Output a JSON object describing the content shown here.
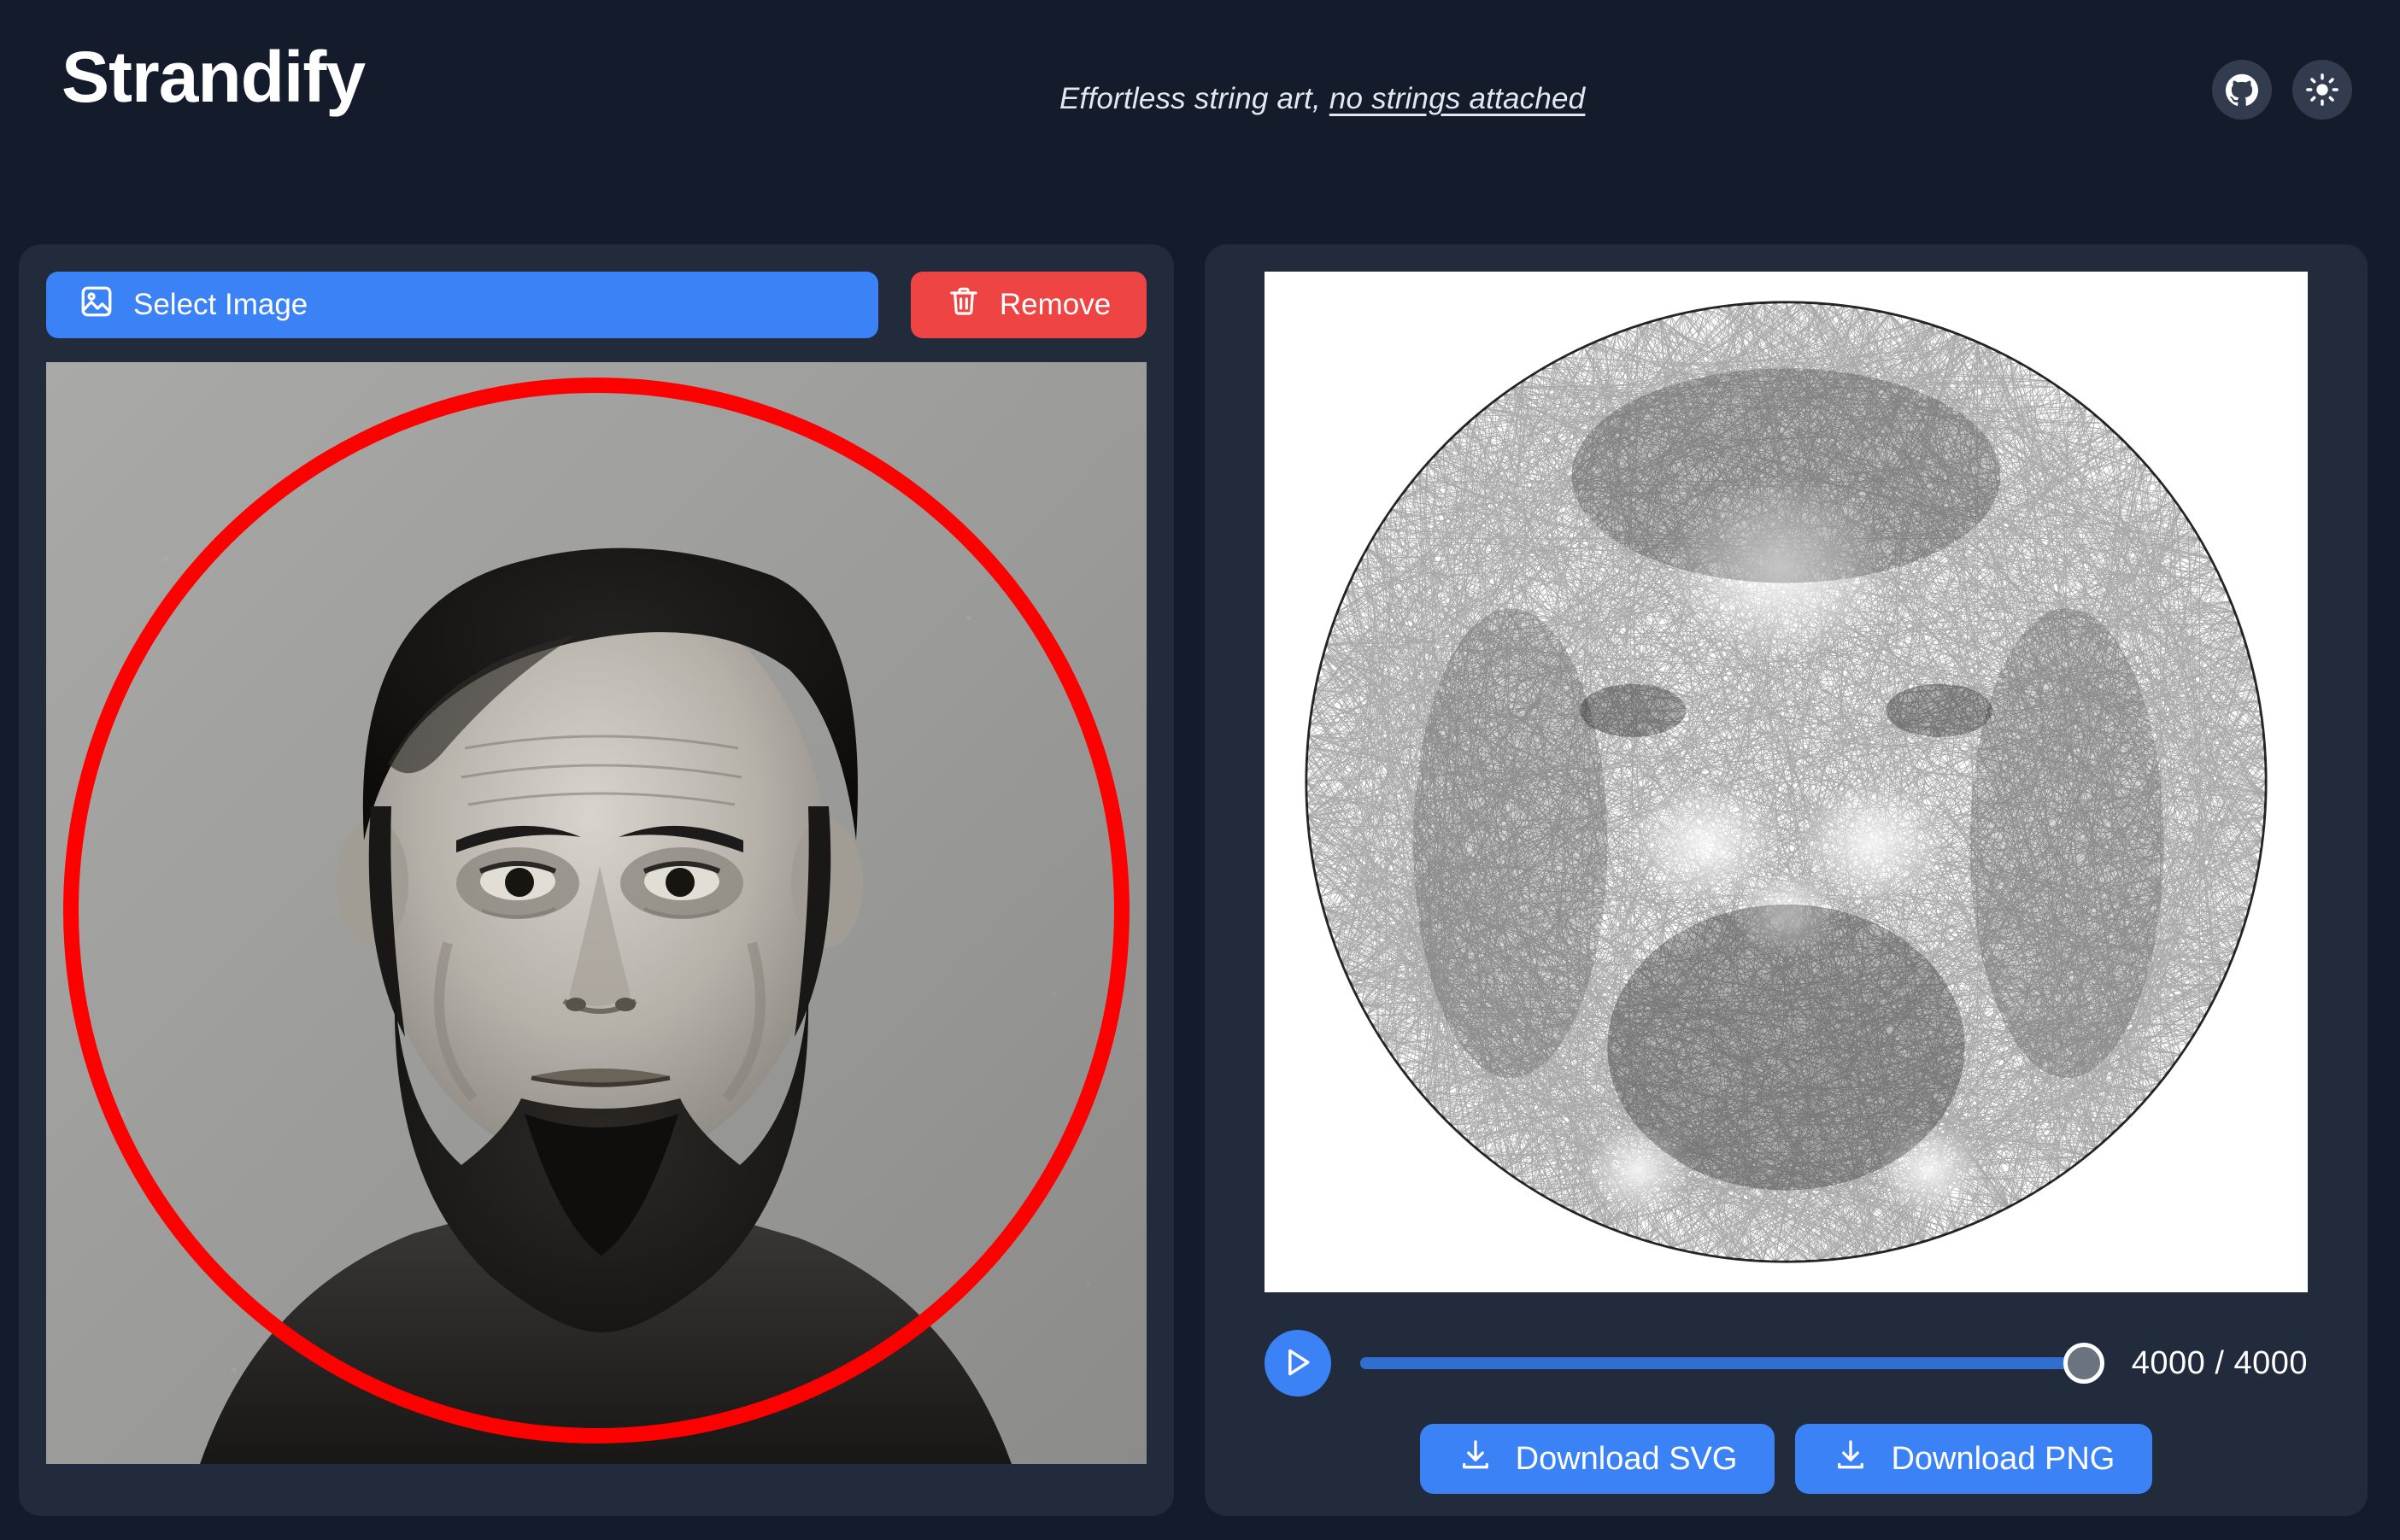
{
  "header": {
    "brand": "Strandify",
    "tagline_prefix": "Effortless string art, ",
    "tagline_link": "no strings attached",
    "github_icon": "github-icon",
    "theme_icon": "sun-icon",
    "accent_color": "#3b82f6",
    "background_color": "#141b2a",
    "panel_color": "#222b3b"
  },
  "left_panel": {
    "select_label": "Select Image",
    "select_icon": "image-icon",
    "remove_label": "Remove",
    "remove_icon": "trash-icon",
    "remove_color": "#ef4444",
    "crop_overlay": {
      "shape": "circle",
      "color": "#ff0000",
      "stroke_width": 18
    },
    "preview_alt": "Abraham Lincoln portrait photograph"
  },
  "right_panel": {
    "canvas_alt": "String art rendering of Abraham Lincoln portrait",
    "canvas_background": "#ffffff",
    "play_label": "play-button",
    "play_icon": "play-icon",
    "progress": {
      "current": 4000,
      "total": 4000,
      "display": "4000 / 4000",
      "percent": 100
    },
    "download_svg_label": "Download SVG",
    "download_png_label": "Download PNG",
    "download_icon": "download-icon"
  }
}
